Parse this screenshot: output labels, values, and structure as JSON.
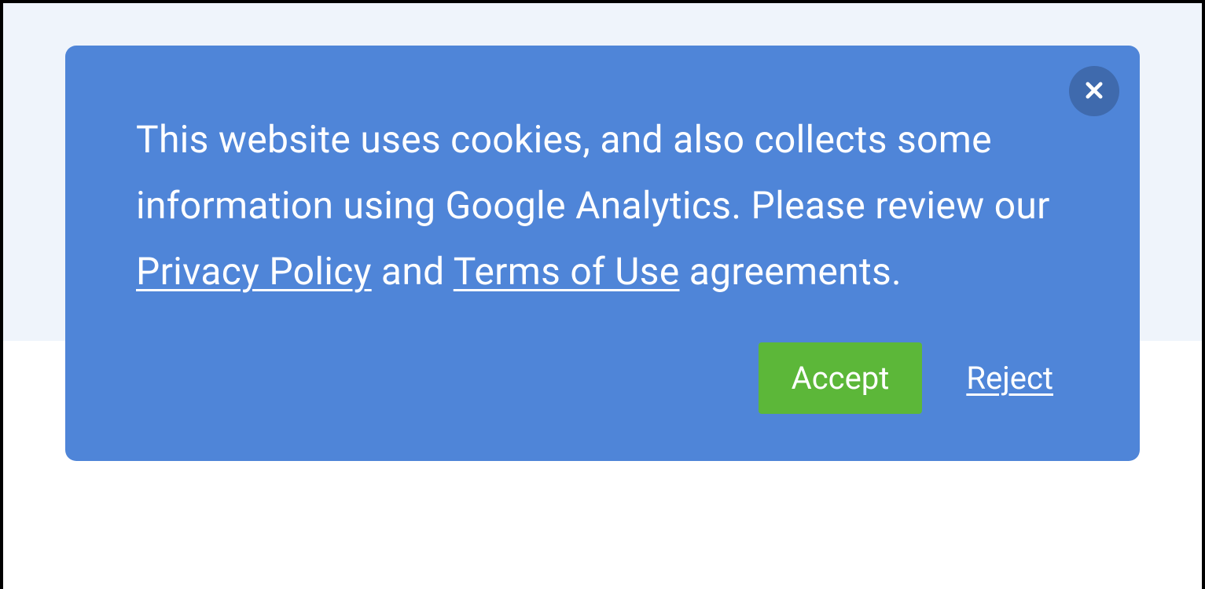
{
  "cookie_banner": {
    "message_parts": {
      "pre": "This website uses cookies, and also collects some information using Google Analytics. Please review our ",
      "privacy_link": "Privacy Policy",
      "mid": " and ",
      "terms_link": "Terms of Use",
      "post": " agreements."
    },
    "accept_label": "Accept",
    "reject_label": "Reject",
    "colors": {
      "banner_bg": "#4f85d8",
      "close_bg": "#3f6aad",
      "accept_bg": "#5cb739"
    }
  }
}
